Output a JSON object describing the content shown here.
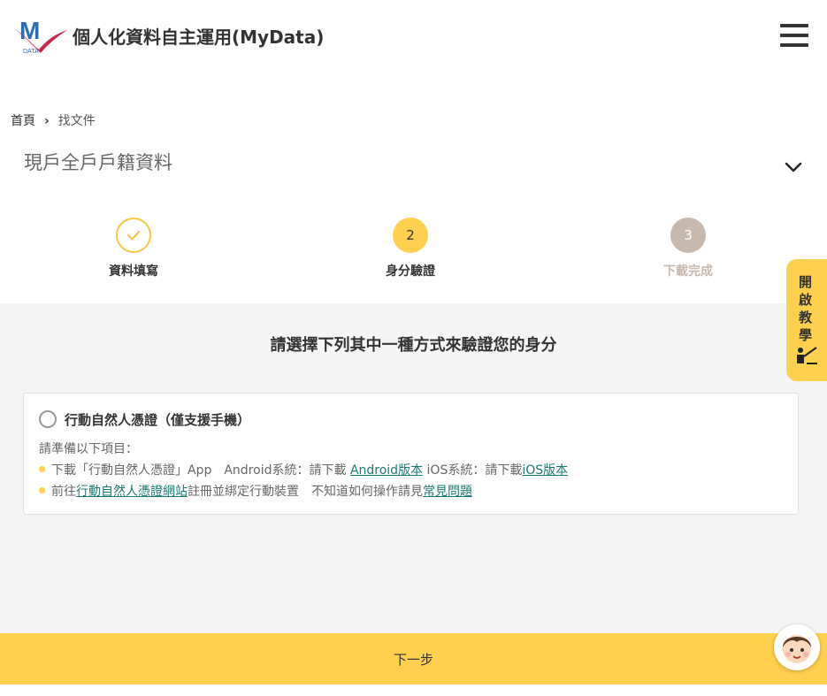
{
  "header": {
    "site_title": "個人化資料自主運用(MyData)",
    "logo_text": "DATA",
    "logo_letter": "M"
  },
  "breadcrumb": {
    "home": "首頁",
    "separator": "›",
    "current": "找文件"
  },
  "document_title": "現戶全戶戶籍資料",
  "steps": [
    {
      "label": "資料填寫",
      "status": "done"
    },
    {
      "number": "2",
      "label": "身分驗證",
      "status": "active"
    },
    {
      "number": "3",
      "label": "下載完成",
      "status": "pending"
    }
  ],
  "side_tab": {
    "label": "開啟教學"
  },
  "prompt": "請選擇下列其中一種方式來驗證您的身分",
  "option": {
    "label": "行動自然人憑證（僅支援手機）",
    "prep_title": "請準備以下項目：",
    "line1_prefix": "下載「行動自然人憑證」App　Android系統：請下載",
    "line1_android_link": "Android版本",
    "line1_ios_text": "iOS系統：請下載",
    "line1_ios_link": "iOS版本",
    "line2_prefix": "前往",
    "line2_site_link": "行動自然人憑證網站",
    "line2_mid": "註冊並綁定行動裝置　不知道如何操作請見",
    "line2_faq_link": "常見問題"
  },
  "next_button": "下一步",
  "colors": {
    "accent": "#ffd04d",
    "link": "#1a7a72",
    "pending": "#c8b9ae"
  }
}
